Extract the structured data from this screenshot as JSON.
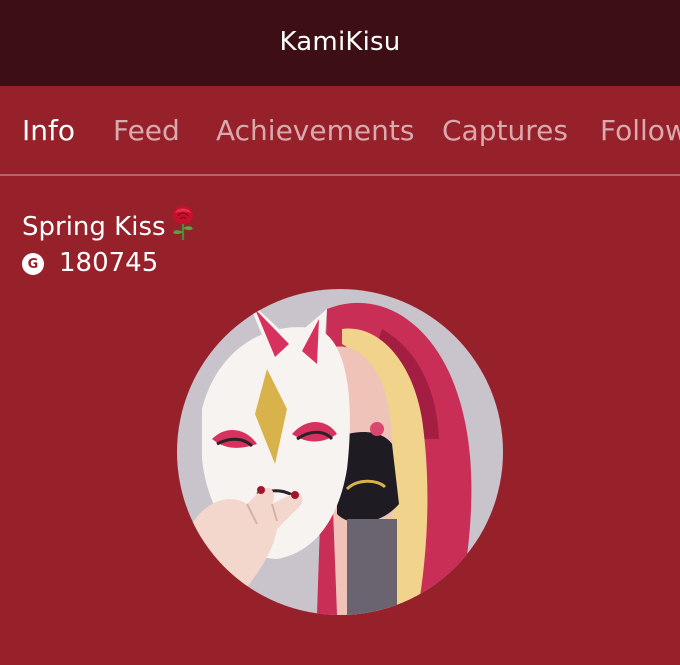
{
  "app": {
    "title": "KamiKisu"
  },
  "tabs": [
    {
      "label": "Info",
      "active": true
    },
    {
      "label": "Feed",
      "active": false
    },
    {
      "label": "Achievements",
      "active": false
    },
    {
      "label": "Captures",
      "active": false
    },
    {
      "label": "Follow",
      "active": false
    }
  ],
  "profile": {
    "real_name": "Spring Kiss",
    "name_emoji": "rose-icon",
    "gamerscore_icon_letter": "G",
    "gamerscore": "180745"
  },
  "colors": {
    "titlebar_bg": "#3d0f14",
    "page_bg": "#97212a",
    "tab_active": "#ffffff",
    "tab_inactive": "#d9a9ad",
    "divider": "#b7656c"
  }
}
